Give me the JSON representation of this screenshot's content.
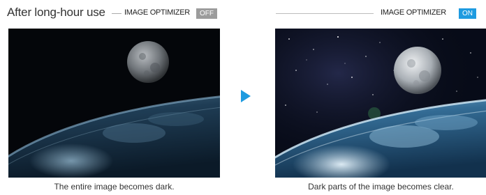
{
  "left_panel": {
    "title": "After long-hour use",
    "optimizer_label": "IMAGE OPTIMIZER",
    "badge": "OFF",
    "caption": "The entire image becomes dark."
  },
  "right_panel": {
    "optimizer_label": "IMAGE OPTIMIZER",
    "badge": "ON",
    "caption": "Dark parts of the image becomes clear."
  },
  "colors": {
    "accent": "#1e9be0",
    "off_badge": "#9c9c9c"
  },
  "icons": {
    "arrow": "play-arrow-icon"
  }
}
